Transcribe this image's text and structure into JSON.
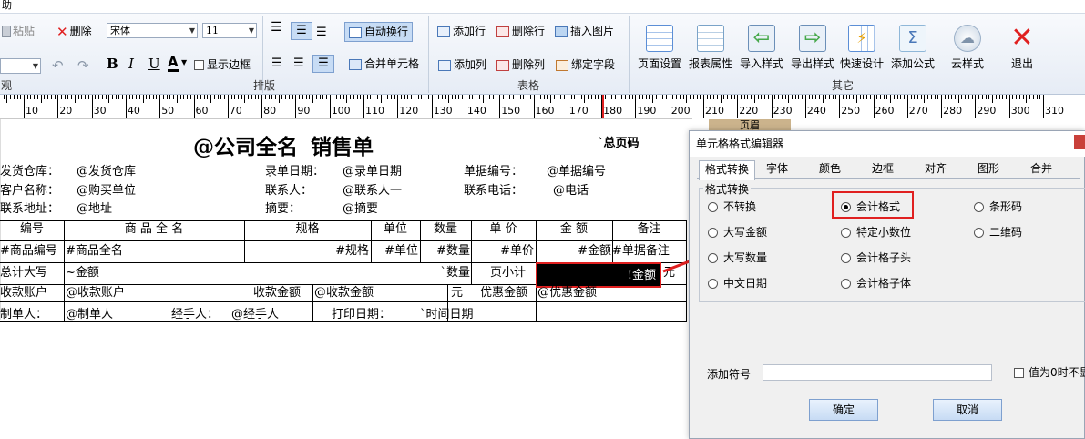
{
  "ribbon": {
    "top_fragment": "助",
    "clipboard": {
      "paste": "粘贴",
      "delete": "删除"
    },
    "font": {
      "family": "宋体",
      "size": "11"
    },
    "format": {
      "bold": "B",
      "italic": "I",
      "underline": "U",
      "color": "A",
      "show_border": "显示边框"
    },
    "layout": {
      "auto_wrap": "自动换行",
      "merge_cells": "合并单元格"
    },
    "table": {
      "add_row": "添加行",
      "delete_row": "删除行",
      "insert_image": "插入图片",
      "add_col": "添加列",
      "delete_col": "删除列",
      "bind_field": "绑定字段"
    },
    "other": [
      {
        "label": "页面设置",
        "color": "#5b8ed6"
      },
      {
        "label": "报表属性",
        "color": "#7aa3c8"
      },
      {
        "label": "导入样式",
        "color": "#46a84a"
      },
      {
        "label": "导出样式",
        "color": "#46a84a"
      },
      {
        "label": "快速设计",
        "color": "#5b8ed6"
      },
      {
        "label": "添加公式",
        "color": "#8fb7d8"
      },
      {
        "label": "云样式",
        "color": "#9bb0c8"
      },
      {
        "label": "退出",
        "color": "#e02020"
      }
    ],
    "groups": {
      "clip_tail": "观",
      "layout": "排版",
      "table": "表格",
      "other": "其它"
    }
  },
  "ruler": {
    "labels": [
      "10",
      "20",
      "30",
      "40",
      "50",
      "60",
      "70",
      "80",
      "90",
      "100",
      "110",
      "120",
      "130",
      "140",
      "150",
      "160",
      "170",
      "180",
      "190",
      "200",
      "210",
      "220",
      "230",
      "240",
      "250",
      "260",
      "270",
      "280",
      "290",
      "300",
      "310"
    ]
  },
  "report": {
    "title": "@公司全名",
    "title_suffix": "销售单",
    "total_pages": "`总页码",
    "page_tab": "页眉",
    "rows": {
      "r1": [
        "发货仓库：",
        "@发货仓库",
        "录单日期：",
        "@录单日期",
        "单据编号：",
        "@单据编号"
      ],
      "r2": [
        "客户名称：",
        "@购买单位",
        "联系人：",
        "@联系人一",
        "联系电话：",
        "@电话"
      ],
      "r3": [
        "联系地址：",
        "@地址",
        "摘要：",
        "@摘要"
      ],
      "header": [
        "编号",
        "商 品 全 名",
        "规格",
        "单位",
        "数量",
        "单 价",
        "金 额",
        "备注"
      ],
      "detail": [
        "#商品编号",
        "#商品全名",
        "#规格",
        "#单位",
        "#数量",
        "#单价",
        "#金额",
        "#单据备注"
      ],
      "total": [
        "总计大写",
        "~金额",
        "`数量",
        "页小计",
        "!金额",
        "元"
      ],
      "account": [
        "收款账户",
        "@收款账户",
        "收款金额",
        "@收款金额",
        "元",
        "优惠金额",
        "@优惠金额"
      ],
      "footer": [
        "制单人：",
        "@制单人",
        "经手人：",
        "@经手人",
        "打印日期：",
        "`时间日期"
      ]
    }
  },
  "dialog": {
    "title": "单元格格式编辑器",
    "tabs": [
      "格式转换",
      "字体",
      "颜色",
      "边框",
      "对齐",
      "图形",
      "合并"
    ],
    "group_title": "格式转换",
    "options": {
      "col1": [
        "不转换",
        "大写金额",
        "大写数量",
        "中文日期"
      ],
      "col2": [
        "会计格式",
        "特定小数位",
        "会计格子头",
        "会计格子体"
      ],
      "col3": [
        "条形码",
        "二维码"
      ]
    },
    "selected": "会计格式",
    "add_symbol_label": "添加符号",
    "zero_hide_label": "值为0时不显",
    "ok": "确定",
    "cancel": "取消"
  },
  "accent": {
    "highlight": "#e02020",
    "selected_cell_bg": "#000000"
  }
}
